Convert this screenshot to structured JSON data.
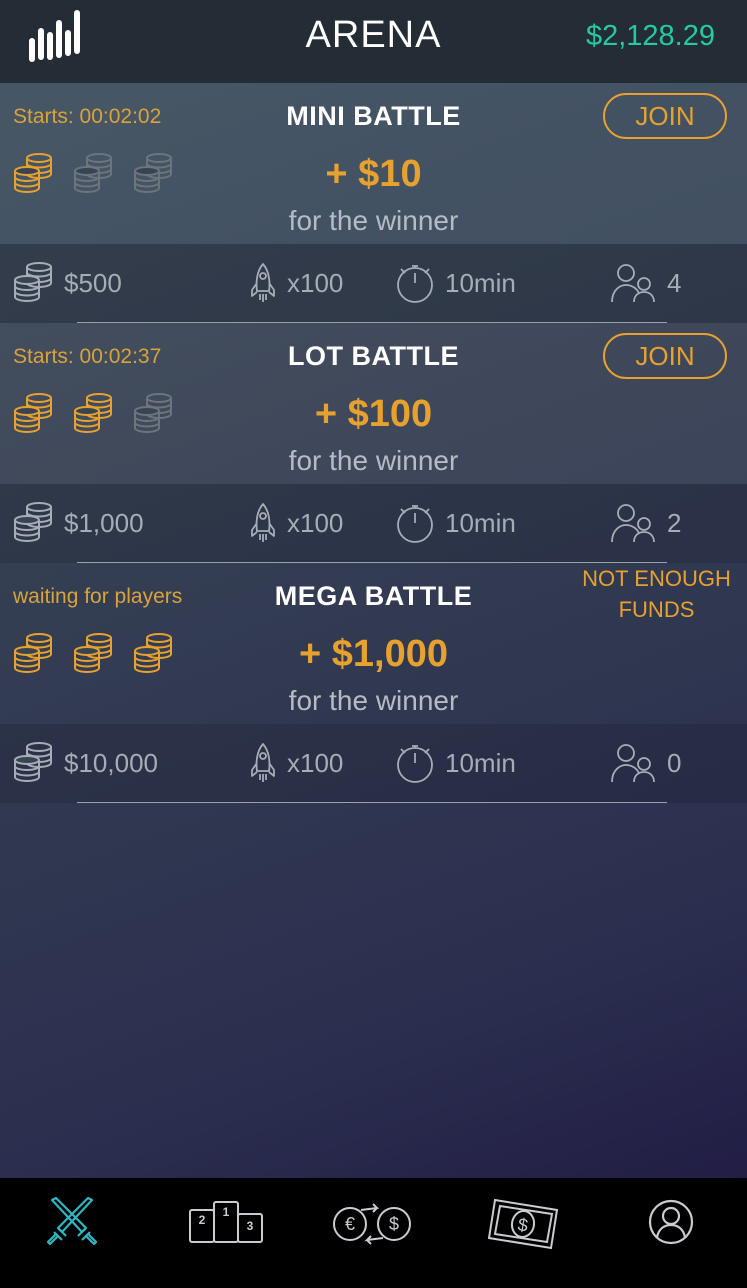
{
  "header": {
    "title": "ARENA",
    "balance": "$2,128.29",
    "logo_icon": "bar-chart-logo-icon",
    "balance_color": "#26c9a0"
  },
  "colors": {
    "accent": "#e7a12e",
    "active_nav": "#2bb8c4",
    "muted_text": "#a7adb6"
  },
  "battles": [
    {
      "status": "Starts: 00:02:02",
      "name": "MINI BATTLE",
      "prize": "+ $10",
      "prize_sub": "for the winner",
      "action": "JOIN",
      "coins_active": 1,
      "entry": "$500",
      "multiplier": "x100",
      "duration": "10min",
      "players": "4"
    },
    {
      "status": "Starts: 00:02:37",
      "name": "LOT BATTLE",
      "prize": "+ $100",
      "prize_sub": "for the winner",
      "action": "JOIN",
      "coins_active": 2,
      "entry": "$1,000",
      "multiplier": "x100",
      "duration": "10min",
      "players": "2"
    },
    {
      "status": "waiting for players",
      "name": "MEGA BATTLE",
      "prize": "+ $1,000",
      "prize_sub": "for the winner",
      "notice_line1": "NOT ENOUGH",
      "notice_line2": "FUNDS",
      "coins_active": 3,
      "entry": "$10,000",
      "multiplier": "x100",
      "duration": "10min",
      "players": "0"
    }
  ],
  "nav": {
    "items": [
      {
        "icon": "crossed-swords-icon",
        "active": true
      },
      {
        "icon": "podium-icon",
        "active": false
      },
      {
        "icon": "currency-exchange-icon",
        "active": false
      },
      {
        "icon": "banknote-icon",
        "active": false
      },
      {
        "icon": "profile-icon",
        "active": false
      }
    ],
    "podium_labels": [
      "2",
      "1",
      "3"
    ]
  }
}
